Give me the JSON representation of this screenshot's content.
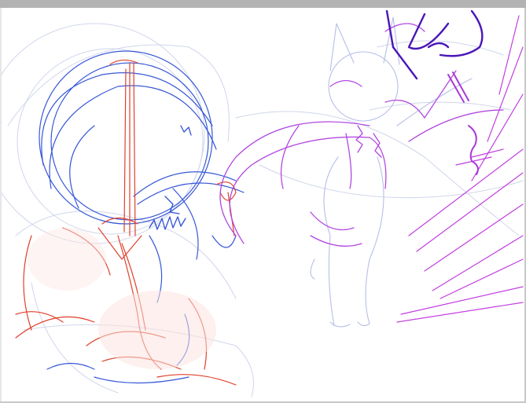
{
  "window": {
    "title": ""
  },
  "canvas": {
    "background": "#ffffff",
    "subject": "sketch-drawing"
  },
  "colors": {
    "titlebar": "#b3b3b3",
    "light_blue": "#9aaee0",
    "blue": "#2f4fd6",
    "red": "#e0402a",
    "purple": "#a93fd6",
    "magenta": "#c23fe0",
    "dark_purple": "#4a16b8",
    "faint_gray": "#cdd3e6"
  }
}
